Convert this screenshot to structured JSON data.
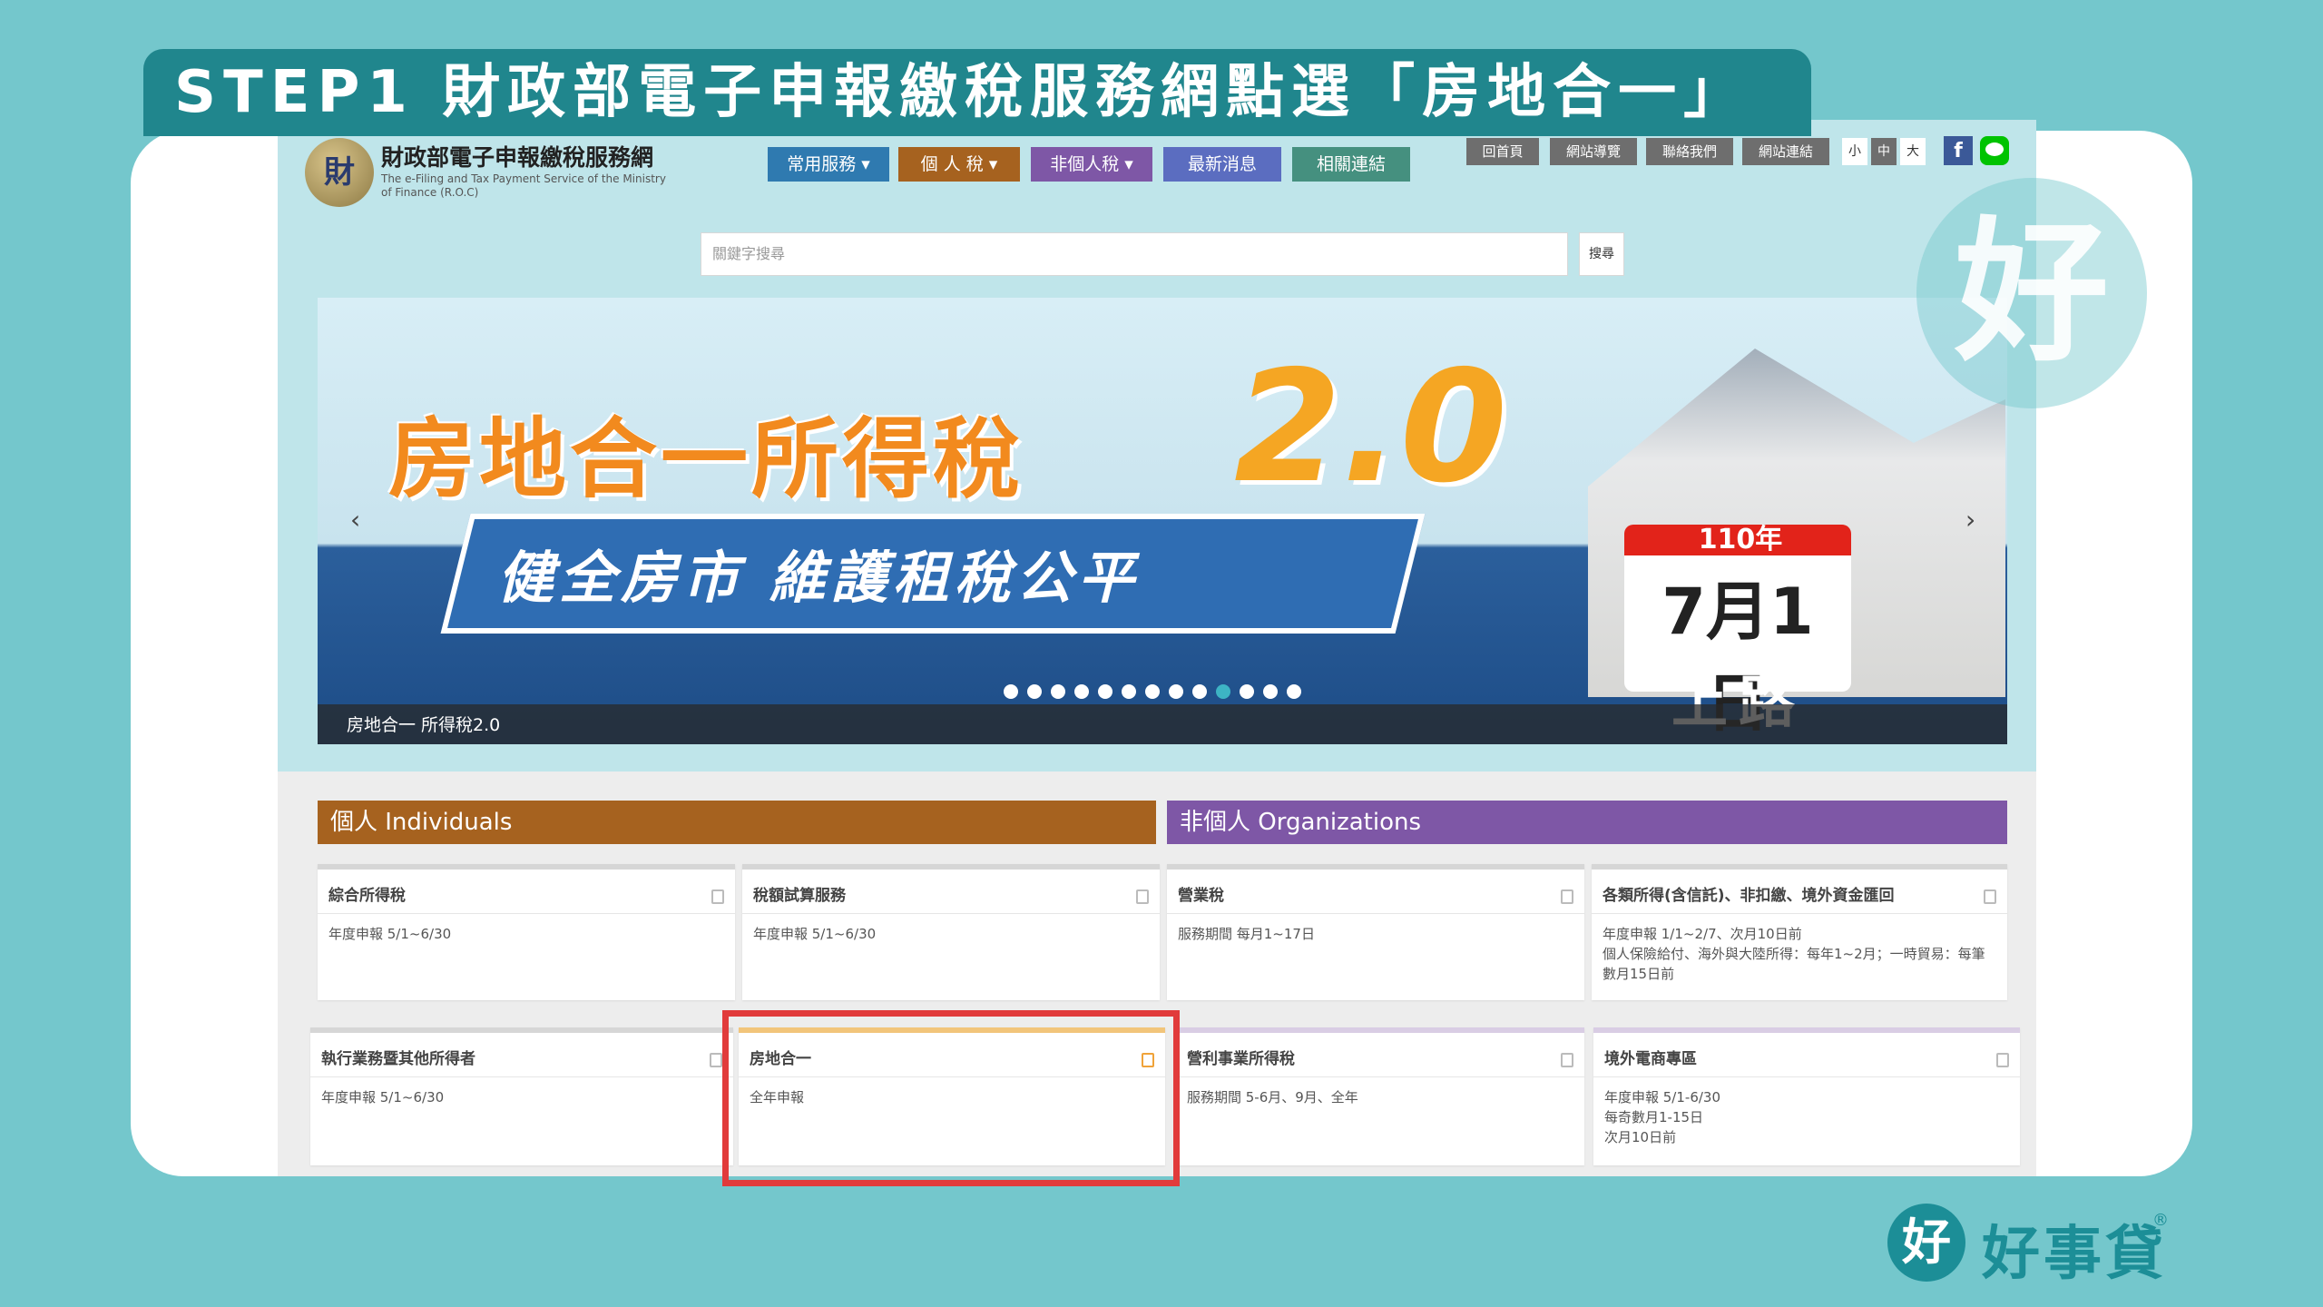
{
  "step_title": "STEP1  財政部電子申報繳稅服務網點選「房地合一」",
  "site": {
    "emblem_char": "財",
    "title": "財政部電子申報繳稅服務網",
    "subtitle_en": "The e-Filing and Tax Payment Service of the Ministry of Finance (R.O.C)"
  },
  "nav": [
    {
      "label": "常用服務 ▾",
      "color": "#2f7ab0"
    },
    {
      "label": "個 人 稅 ▾",
      "color": "#a6621f"
    },
    {
      "label": "非個人稅 ▾",
      "color": "#7e57a6"
    },
    {
      "label": "最新消息",
      "color": "#5b6dc0"
    },
    {
      "label": "相關連結",
      "color": "#45907f"
    }
  ],
  "util_links": [
    "回首頁",
    "網站導覽",
    "聯絡我們",
    "網站連結"
  ],
  "font_sizes": [
    "小",
    "中",
    "大"
  ],
  "social": {
    "facebook": "f",
    "line": "line-icon"
  },
  "search": {
    "placeholder": "關鍵字搜尋",
    "button": "搜尋"
  },
  "hero": {
    "title": "房地合一所得稅",
    "version": "2.0",
    "slogan": "健全房市  維護租稅公平",
    "calendar_year": "110年",
    "calendar_date": "7月1日",
    "calendar_road": "上路",
    "caption": "房地合一 所得稅2.0",
    "prev": "‹",
    "next": "›",
    "slide_count": 13,
    "active_slide": 10
  },
  "sections": {
    "individual": {
      "label": "個人 Individuals",
      "color": "#a6621f"
    },
    "organization": {
      "label": "非個人 Organizations",
      "color": "#7e57a6"
    }
  },
  "tiles": [
    {
      "title": "綜合所得稅",
      "desc": "年度申報 5/1~6/30"
    },
    {
      "title": "稅額試算服務",
      "desc": "年度申報 5/1~6/30"
    },
    {
      "title": "營業稅",
      "desc": "服務期間 每月1~17日"
    },
    {
      "title": "各類所得(含信託)、非扣繳、境外資金匯回",
      "desc": "年度申報 1/1~2/7、次月10日前\n個人保險給付、海外與大陸所得：每年1~2月；一時貿易：每筆數月15日前"
    },
    {
      "title": "執行業務暨其他所得者",
      "desc": "年度申報 5/1~6/30"
    },
    {
      "title": "房地合一",
      "desc": "全年申報"
    },
    {
      "title": "營利事業所得稅",
      "desc": "服務期間 5-6月、9月、全年"
    },
    {
      "title": "境外電商專區",
      "desc": "年度申報 5/1-6/30\n每奇數月1-15日\n次月10日前"
    }
  ],
  "watermark_char": "好",
  "brand": {
    "logo_char": "好",
    "name": "好事貸",
    "reg": "®"
  }
}
